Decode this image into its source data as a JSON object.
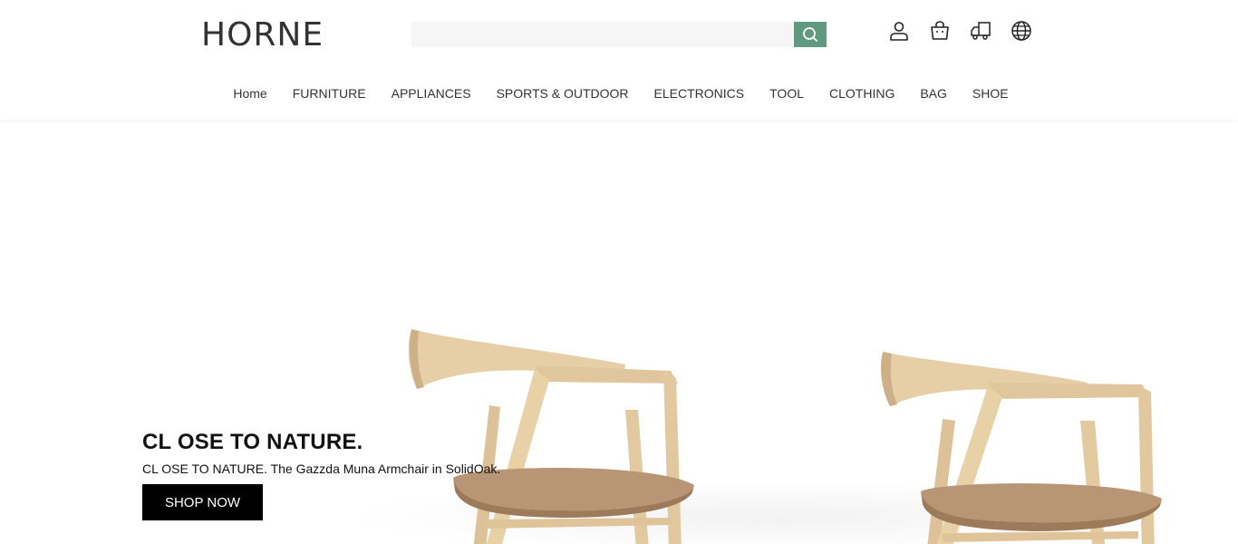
{
  "brand": {
    "logo": "HORNE"
  },
  "search": {
    "value": "",
    "placeholder": ""
  },
  "header_icons": [
    "account-icon",
    "cart-icon",
    "shipping-icon",
    "globe-icon"
  ],
  "nav": {
    "items": [
      "Home",
      "FURNITURE",
      "APPLIANCES",
      "SPORTS & OUTDOOR",
      "ELECTRONICS",
      "TOOL",
      "CLOTHING",
      "BAG",
      "SHOE"
    ]
  },
  "hero": {
    "title": "CL OSE TO NATURE.",
    "subtitle": "CL OSE TO NATURE. The Gazzda Muna Armchair in SolidOak.",
    "cta": "SHOP NOW"
  },
  "colors": {
    "accent": "#5f9a80",
    "button": "#000000",
    "wood": "#e3c99f",
    "seat": "#b89575"
  }
}
